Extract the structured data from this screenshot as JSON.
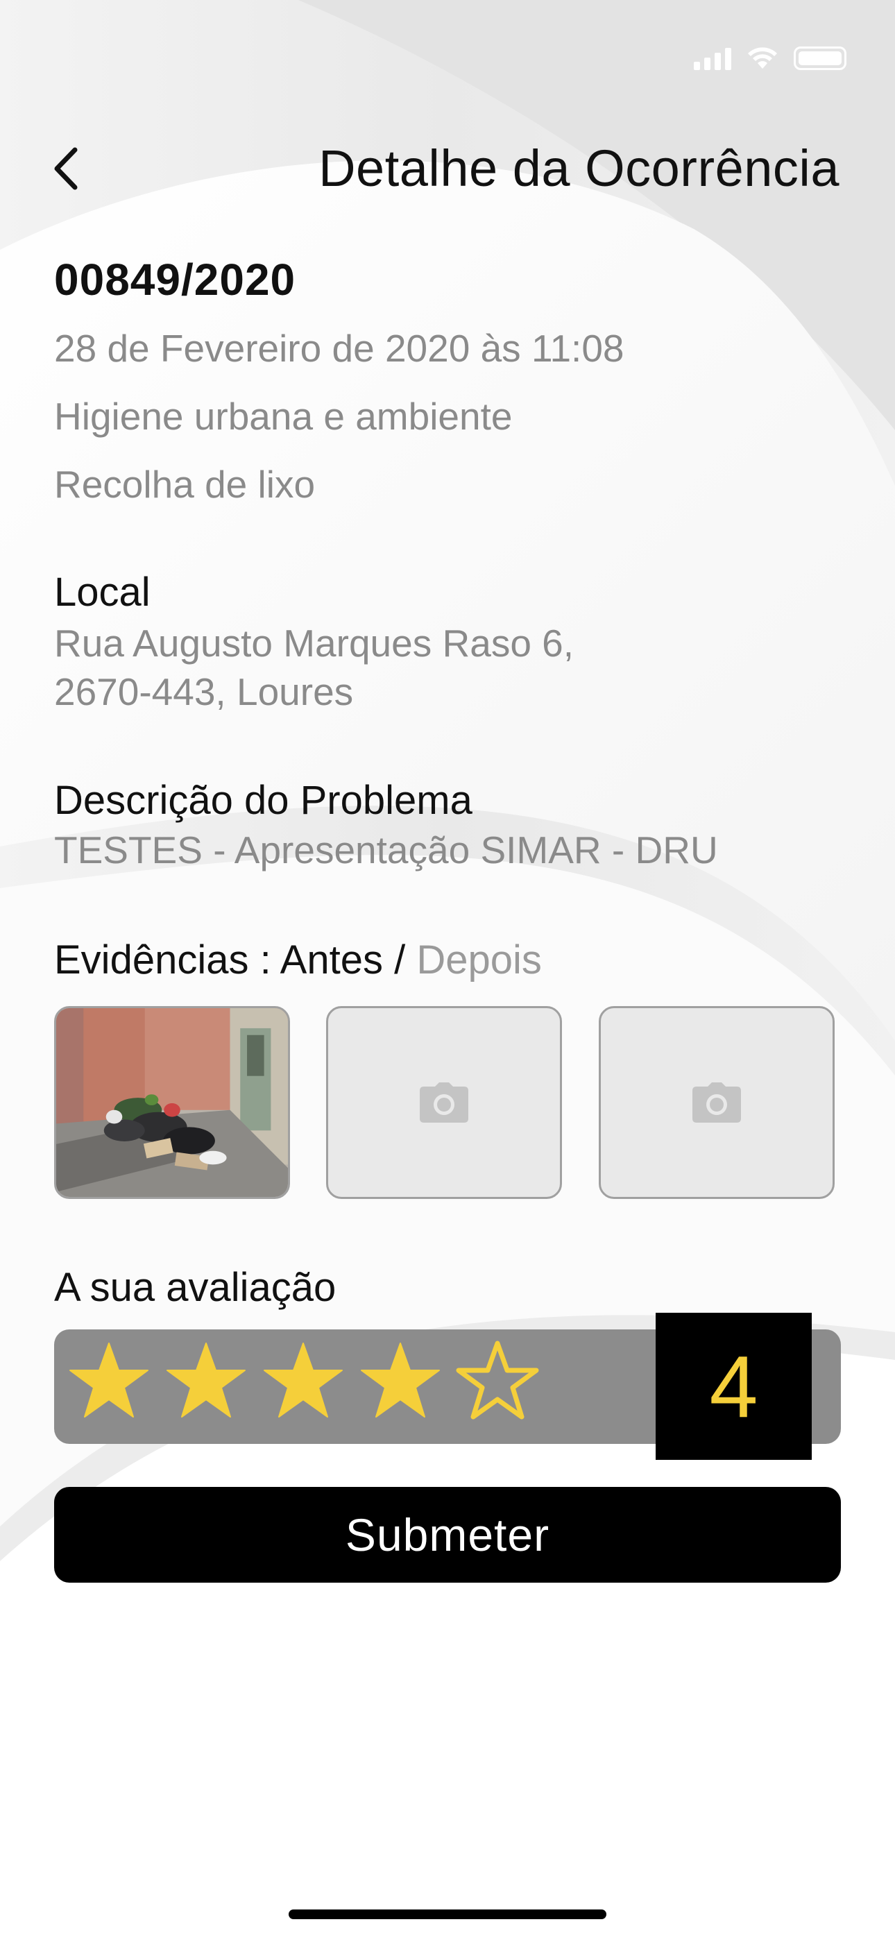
{
  "header": {
    "title": "Detalhe da Ocorrência",
    "back_icon": "chevron-left-icon"
  },
  "occurrence": {
    "number": "00849/2020",
    "datetime": "28 de Fevereiro de 2020 às 11:08",
    "category": "Higiene urbana e ambiente",
    "subcategory": "Recolha de lixo"
  },
  "location": {
    "label": "Local",
    "line1": "Rua Augusto Marques Raso 6,",
    "line2": "2670-443, Loures"
  },
  "description": {
    "label": "Descrição do Problema",
    "text": "TESTES - Apresentação SIMAR - DRU"
  },
  "evidence": {
    "label": "Evidências : ",
    "tab_before": "Antes",
    "separator": " / ",
    "tab_after": "Depois",
    "active_tab": "Antes",
    "slots": [
      {
        "type": "photo",
        "icon": "street-trash-photo"
      },
      {
        "type": "empty",
        "icon": "camera-icon"
      },
      {
        "type": "empty",
        "icon": "camera-icon"
      }
    ]
  },
  "rating": {
    "label": "A sua avaliação",
    "value": 4,
    "max": 5,
    "display": "4",
    "star_color": "#f5cf3a",
    "bar_color": "#8c8c8c"
  },
  "actions": {
    "submit_label": "Submeter"
  },
  "colors": {
    "primary_text": "#111111",
    "secondary_text": "#8a8a8a",
    "button_bg": "#000000",
    "button_text": "#ffffff"
  }
}
